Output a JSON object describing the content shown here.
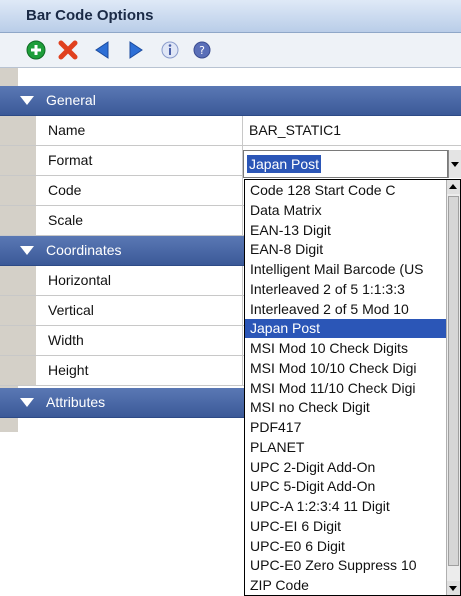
{
  "window": {
    "title": "Bar Code Options"
  },
  "toolbar": {
    "icons": [
      "add-icon",
      "delete-icon",
      "back-icon",
      "forward-icon",
      "info-icon",
      "help-icon"
    ],
    "colors": {
      "add": "#1e9e3a",
      "delete": "#e0401e",
      "nav": "#2d6fd6",
      "help": "#5a6fb8"
    }
  },
  "categories": {
    "general": "General",
    "coordinates": "Coordinates",
    "attributes": "Attributes"
  },
  "properties": {
    "name": {
      "label": "Name",
      "value": "BAR_STATIC1"
    },
    "format": {
      "label": "Format",
      "value": "Japan Post"
    },
    "code": {
      "label": "Code"
    },
    "scale": {
      "label": "Scale"
    },
    "horizontal": {
      "label": "Horizontal"
    },
    "vertical": {
      "label": "Vertical"
    },
    "width": {
      "label": "Width"
    },
    "height": {
      "label": "Height"
    }
  },
  "dropdown": {
    "selected": "Japan Post",
    "options": [
      "Code 128 Start Code C",
      "Data Matrix",
      "EAN-13 Digit",
      "EAN-8 Digit",
      "Intelligent Mail Barcode (US",
      "Interleaved 2 of 5 1:1:3:3",
      "Interleaved 2 of 5 Mod 10",
      "Japan Post",
      "MSI Mod 10 Check Digits",
      "MSI Mod 10/10 Check Digi",
      "MSI Mod 11/10 Check Digi",
      "MSI no Check Digit",
      "PDF417",
      "PLANET",
      "UPC 2-Digit Add-On",
      "UPC 5-Digit Add-On",
      "UPC-A 1:2:3:4 11 Digit",
      "UPC-EI 6 Digit",
      "UPC-E0 6 Digit",
      "UPC-E0 Zero Suppress 10",
      "ZIP Code"
    ]
  },
  "colors": {
    "category_bg": "#3b5998",
    "selection": "#2b56b7",
    "panel": "#d4d0c8"
  }
}
